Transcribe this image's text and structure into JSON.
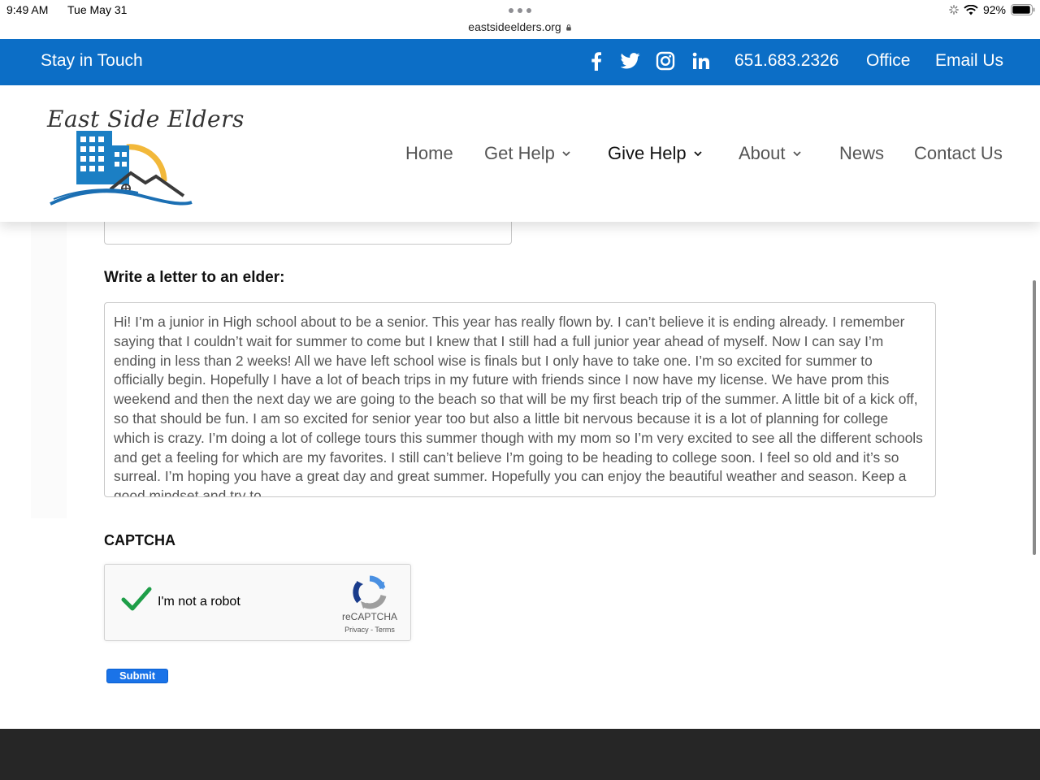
{
  "status_bar": {
    "time": "9:49 AM",
    "date": "Tue May 31",
    "url": "eastsideelders.org",
    "battery": "92%"
  },
  "top_bar": {
    "tagline": "Stay in Touch",
    "phone": "651.683.2326",
    "office": "Office",
    "email": "Email Us",
    "social_icons": [
      "facebook-icon",
      "twitter-icon",
      "instagram-icon",
      "linkedin-icon"
    ],
    "color": "#0c6ec6"
  },
  "logo": {
    "text": "East Side Elders"
  },
  "nav": {
    "home": "Home",
    "get_help": "Get Help",
    "give_help": "Give Help",
    "about": "About",
    "news": "News",
    "contact": "Contact Us",
    "active": "Give Help"
  },
  "form": {
    "letter_label": "Write a letter to an elder:",
    "letter_value": "Hi! I’m a junior in High school about to be a senior. This year has really flown by. I can’t believe it is ending already. I remember saying that I couldn’t wait for summer to come but I knew that I still had a full junior year ahead of myself. Now I can say I’m ending in less than 2 weeks! All we have left school wise is finals but I only have to take one. I’m so excited for summer to officially begin. Hopefully I have a lot of beach trips in my future with friends since I now have my license. We have prom this weekend and then the next day we are going to the beach so that will be my first beach trip of the summer. A little bit of a kick off, so that should be fun. I am so excited for senior year too but also a little bit nervous because it is a lot of planning for college which is crazy. I’m doing a lot of college tours this summer though with my mom so I’m very excited to see all the different schools and get a feeling for which are my favorites. I still can’t believe I’m going to be heading to college soon. I feel so old and it’s so surreal. I’m hoping you have a great day and great summer. Hopefully you can enjoy the beautiful weather and season. Keep a good mindset and try to",
    "captcha_label": "CAPTCHA",
    "recaptcha_label": "I'm not a robot",
    "recaptcha_brand": "reCAPTCHA",
    "recaptcha_terms": "Privacy - Terms",
    "recaptcha_checked": true,
    "submit_label": "Submit"
  }
}
